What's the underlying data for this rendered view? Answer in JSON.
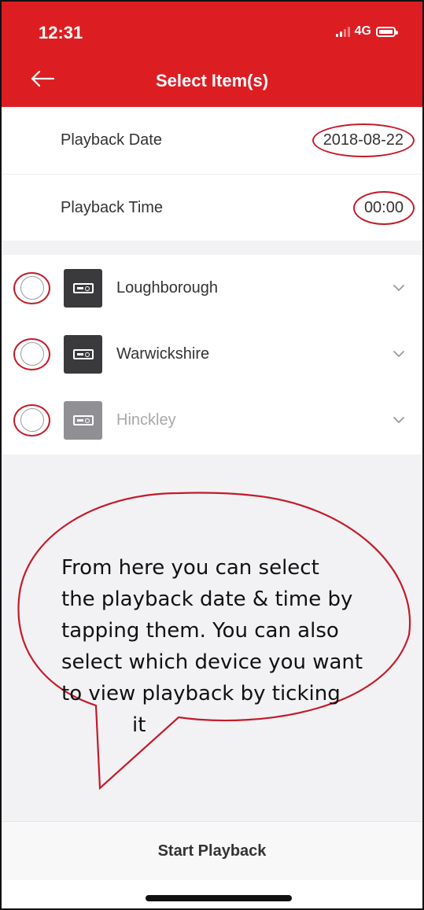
{
  "status": {
    "time": "12:31",
    "network": "4G"
  },
  "header": {
    "title": "Select Item(s)"
  },
  "playback": {
    "date_label": "Playback Date",
    "date_value": "2018-08-22",
    "time_label": "Playback Time",
    "time_value": "00:00"
  },
  "devices": [
    {
      "name": "Loughborough",
      "online": true
    },
    {
      "name": "Warwickshire",
      "online": true
    },
    {
      "name": "Hinckley",
      "online": false
    }
  ],
  "annotation": {
    "lines": [
      "From here you can select",
      "the playback date & time by",
      "tapping them. You can also",
      "select which device you want",
      "to view playback by ticking",
      "it"
    ]
  },
  "footer": {
    "start_label": "Start Playback"
  },
  "colors": {
    "brand_red": "#dc1e23",
    "annotation_red": "#c31b2a"
  }
}
